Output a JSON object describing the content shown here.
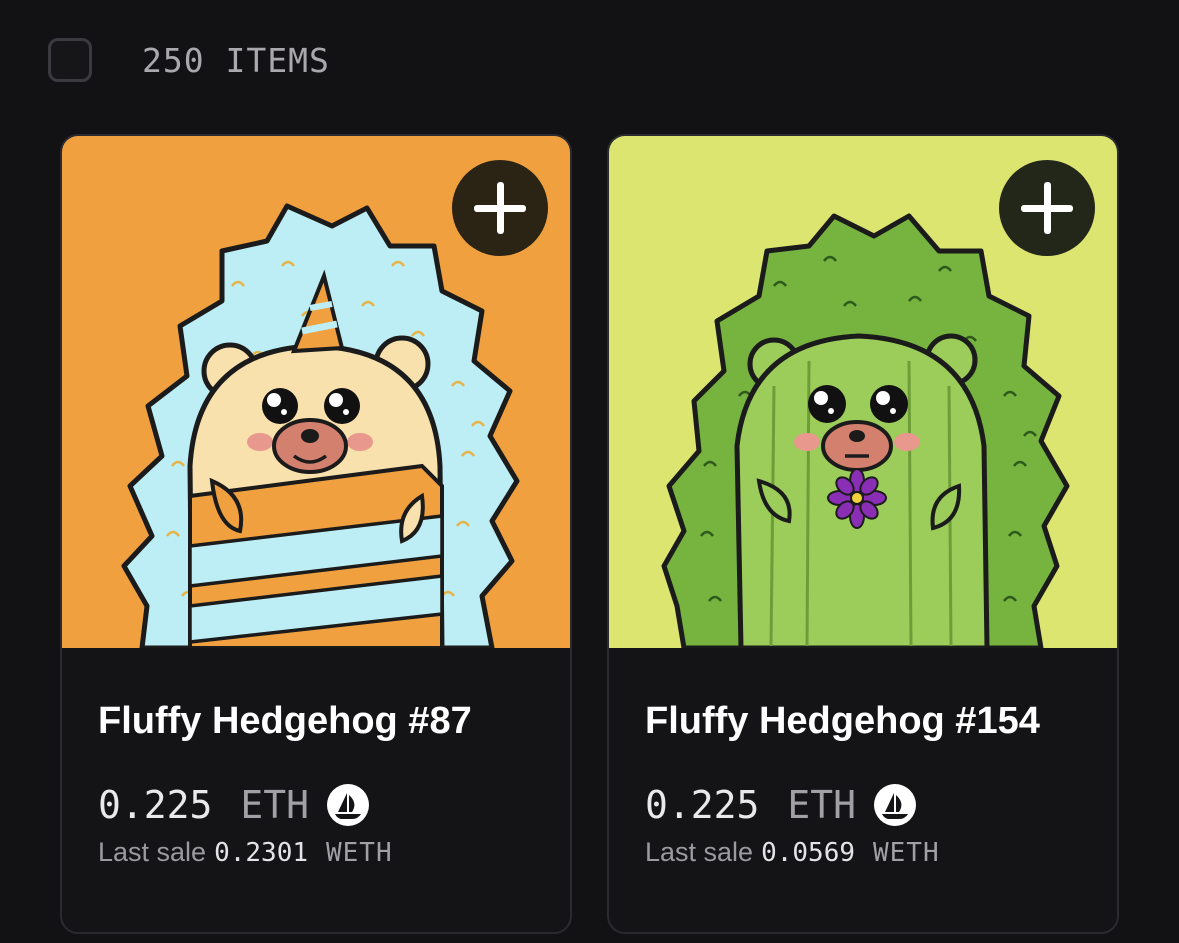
{
  "header": {
    "item_count": "250 ITEMS"
  },
  "cards": [
    {
      "name": "Fluffy Hedgehog #87",
      "price_value": "0.225",
      "price_unit": "ETH",
      "last_sale_label": "Last sale",
      "last_sale_value": "0.2301",
      "last_sale_unit": "WETH",
      "art_bg_color": "#f0a03e",
      "art_theme": "unicorn hedgehog, light blue spikes, orange-striped body"
    },
    {
      "name": "Fluffy Hedgehog #154",
      "price_value": "0.225",
      "price_unit": "ETH",
      "last_sale_label": "Last sale",
      "last_sale_value": "0.0569",
      "last_sale_unit": "WETH",
      "art_bg_color": "#dde571",
      "art_theme": "cactus hedgehog, green spikes, purple flower"
    }
  ],
  "icons": {
    "add": "plus-icon",
    "marketplace": "opensea-ship-icon",
    "select": "checkbox"
  },
  "colors": {
    "page_bg": "#121214",
    "card_bg": "#141416",
    "card_border": "#2a2b30",
    "muted_text": "#a0a0a6"
  }
}
